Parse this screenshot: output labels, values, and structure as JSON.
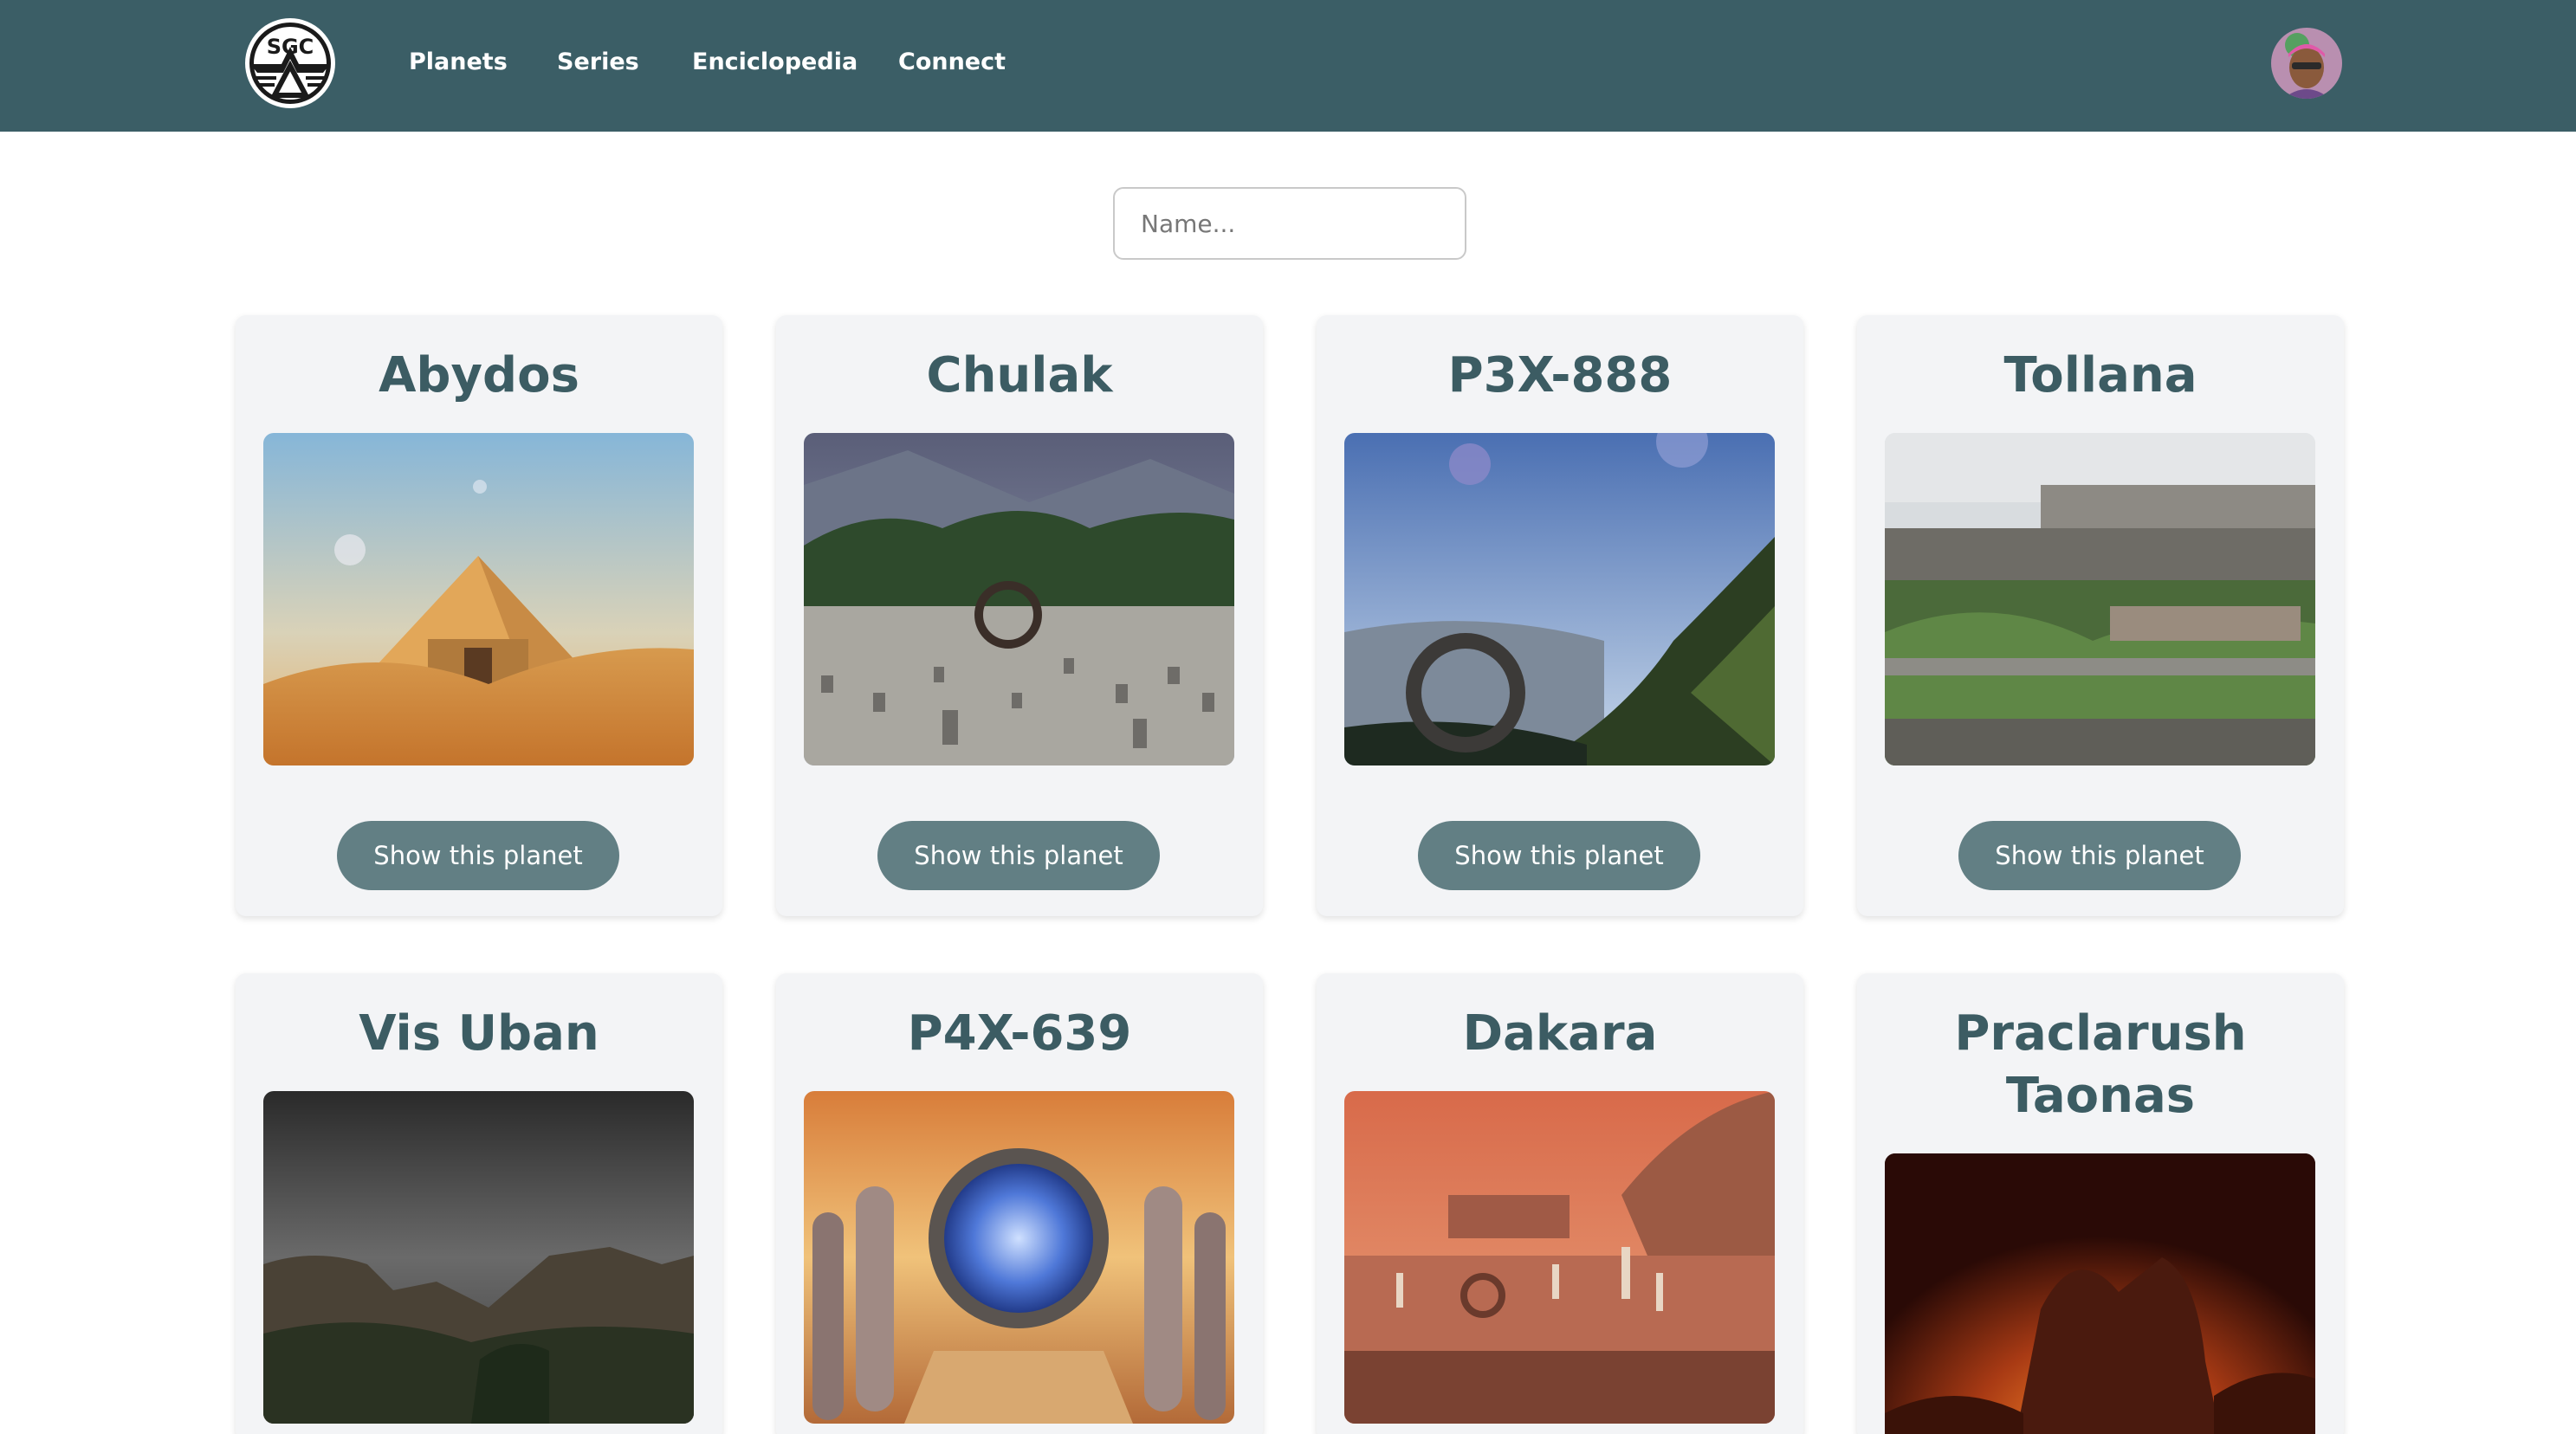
{
  "nav": {
    "logo_text": "SGC",
    "logo_icon": "sgc-emblem-icon",
    "links": [
      "Planets",
      "Series",
      "Enciclopedia",
      "Connect"
    ],
    "avatar_icon": "user-avatar"
  },
  "search": {
    "placeholder": "Name..."
  },
  "colors": {
    "navbar": "#3b5e66",
    "title_text": "#3c5c63",
    "button": "#627f84",
    "card_bg": "#f3f4f6"
  },
  "planets": [
    {
      "name": "Abydos",
      "button_label": "Show this planet"
    },
    {
      "name": "Chulak",
      "button_label": "Show this planet"
    },
    {
      "name": "P3X-888",
      "button_label": "Show this planet"
    },
    {
      "name": "Tollana",
      "button_label": "Show this planet"
    },
    {
      "name": "Vis Uban"
    },
    {
      "name": "P4X-639"
    },
    {
      "name": "Dakara"
    },
    {
      "name": "Praclarush Taonas"
    }
  ]
}
